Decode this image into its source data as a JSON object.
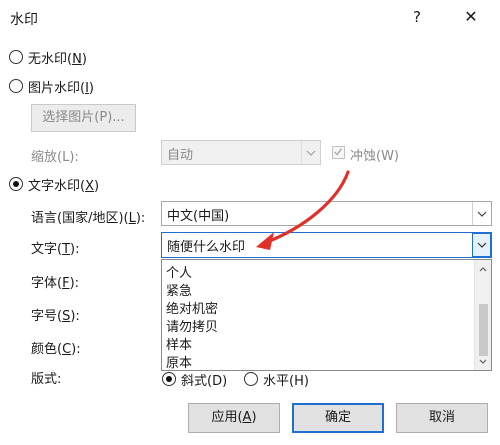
{
  "window": {
    "title": "水印",
    "help_label": "?",
    "close_label": "✕"
  },
  "options": {
    "no_watermark": {
      "label": "无水印(",
      "key": "N",
      "tail": ")"
    },
    "picture_watermark": {
      "label": "图片水印(",
      "key": "I",
      "tail": ")"
    },
    "select_picture_button": "选择图片(P)...",
    "scale_label": "缩放(L):",
    "scale_value": "自动",
    "washout_label": "冲蚀(W)",
    "text_watermark": {
      "label": "文字水印(",
      "key": "X",
      "tail": ")"
    }
  },
  "fields": {
    "language": {
      "label": "语言(国家/地区)(",
      "key": "L",
      "tail": "):",
      "value": "中文(中国)"
    },
    "text": {
      "label": "文字(",
      "key": "T",
      "tail": "):",
      "value": "随便什么水印"
    },
    "font": {
      "label": "字体(",
      "key": "F",
      "tail": "):"
    },
    "size": {
      "label": "字号(",
      "key": "S",
      "tail": "):"
    },
    "color": {
      "label": "颜色(",
      "key": "C",
      "tail": "):"
    },
    "layout": {
      "label": "版式:",
      "opt1": "斜式(D)",
      "opt2": "水平(H)"
    }
  },
  "text_dropdown_items": [
    "个人",
    "紧急",
    "绝对机密",
    "请勿拷贝",
    "样本",
    "原本"
  ],
  "buttons": {
    "apply": {
      "label": "应用(",
      "key": "A",
      "tail": ")"
    },
    "ok": "确定",
    "cancel": "取消"
  },
  "colors": {
    "annotation_arrow": "#e0302a",
    "focus_blue": "#1f6fd1"
  }
}
